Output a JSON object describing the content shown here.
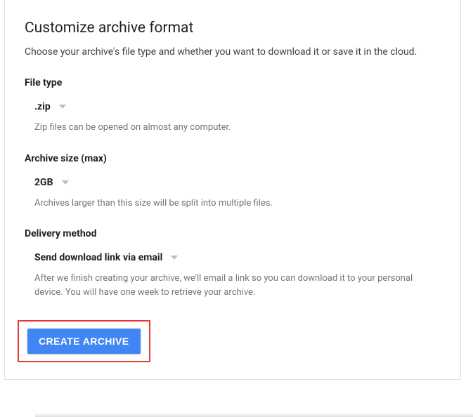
{
  "title": "Customize archive format",
  "subtitle": "Choose your archive's file type and whether you want to download it or save it in the cloud.",
  "file_type": {
    "label": "File type",
    "value": ".zip",
    "hint": "Zip files can be opened on almost any computer."
  },
  "archive_size": {
    "label": "Archive size (max)",
    "value": "2GB",
    "hint": "Archives larger than this size will be split into multiple files."
  },
  "delivery_method": {
    "label": "Delivery method",
    "value": "Send download link via email",
    "hint": "After we finish creating your archive, we'll email a link so you can download it to your personal device. You will have one week to retrieve your archive."
  },
  "create_button_label": "CREATE ARCHIVE"
}
